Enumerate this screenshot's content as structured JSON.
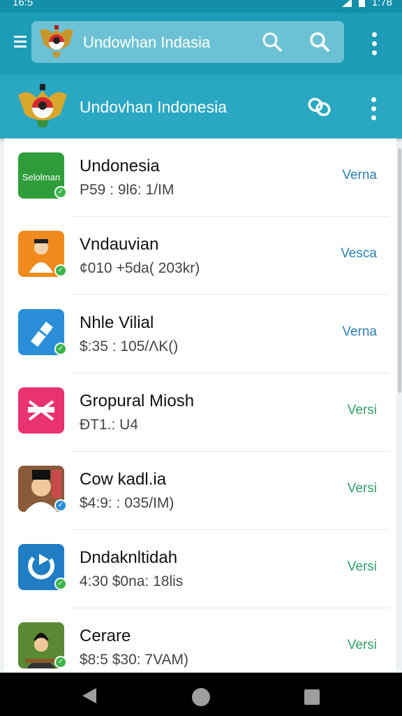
{
  "status_bar": {
    "time": "16:5",
    "right_text": "1:78"
  },
  "search": {
    "query": "Undowhan Indasia"
  },
  "app_bar": {
    "title": "Undovhan Indonesia"
  },
  "colors": {
    "primary": "#1c9cb6",
    "accent_blue": "#2a7fb0",
    "accent_green": "#2f9e6a"
  },
  "apps": [
    {
      "name": "Undonesia",
      "meta": "P59 : 9l6: 1/IM",
      "version": "Verna",
      "icon": "seloman-green-tile",
      "icon_text": "Selolman",
      "version_color": "#2a7fb0"
    },
    {
      "name": "Vndauvian",
      "meta": "¢010 +5da( 203kr)",
      "version": "Vesca",
      "icon": "person-orange-tile",
      "version_color": "#2a7fb0"
    },
    {
      "name": "Nhle Vilial",
      "meta": "$:35 : 105/ΛK()",
      "version": "Verna",
      "icon": "ticket-blue-tile",
      "version_color": "#2a7fb0"
    },
    {
      "name": "Gropural Miosh",
      "meta": "ÐT1.: U4",
      "version": "Versi",
      "icon": "crossed-pink-tile",
      "version_color": "#2f9e6a"
    },
    {
      "name": "Cow kadl.ia",
      "meta": "$4:9: : 035/IM)",
      "version": "Versi",
      "icon": "portrait-photo-tile",
      "version_color": "#2f9e6a"
    },
    {
      "name": "Dndaknltidah",
      "meta": "4:30 $0na: 18lis",
      "version": "Versi",
      "icon": "cycle-blue-tile",
      "version_color": "#2f9e6a"
    },
    {
      "name": "Cerare",
      "meta": "$8:5 $30: 7VAM)",
      "version": "Versi",
      "icon": "avatar-green-tile",
      "version_color": "#2f9e6a"
    }
  ]
}
